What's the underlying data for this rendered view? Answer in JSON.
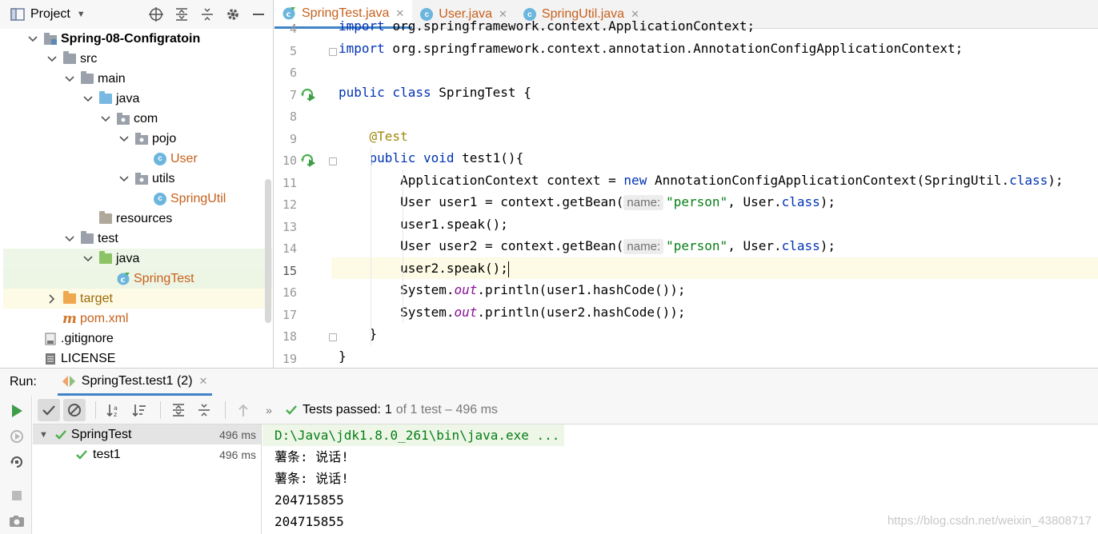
{
  "project": {
    "title": "Project",
    "tree": [
      {
        "label": "Spring-08-Configratoin",
        "depth": 1,
        "arrow": "down",
        "icon": "module",
        "style": "bold"
      },
      {
        "label": "src",
        "depth": 2,
        "arrow": "down",
        "icon": "folder-grey"
      },
      {
        "label": "main",
        "depth": 3,
        "arrow": "down",
        "icon": "folder-grey"
      },
      {
        "label": "java",
        "depth": 4,
        "arrow": "down",
        "icon": "folder-blue"
      },
      {
        "label": "com",
        "depth": 5,
        "arrow": "down",
        "icon": "package"
      },
      {
        "label": "pojo",
        "depth": 6,
        "arrow": "down",
        "icon": "package"
      },
      {
        "label": "User",
        "depth": 7,
        "arrow": "",
        "icon": "class",
        "style": "orange"
      },
      {
        "label": "utils",
        "depth": 6,
        "arrow": "down",
        "icon": "package"
      },
      {
        "label": "SpringUtil",
        "depth": 7,
        "arrow": "",
        "icon": "class",
        "style": "orange"
      },
      {
        "label": "resources",
        "depth": 4,
        "arrow": "",
        "icon": "folder-res"
      },
      {
        "label": "test",
        "depth": 3,
        "arrow": "down",
        "icon": "folder-grey"
      },
      {
        "label": "java",
        "depth": 4,
        "arrow": "down",
        "icon": "folder-green",
        "row": "hl"
      },
      {
        "label": "SpringTest",
        "depth": 5,
        "arrow": "",
        "icon": "test-class",
        "style": "orange",
        "row": "sel"
      },
      {
        "label": "target",
        "depth": 2,
        "arrow": "right",
        "icon": "folder-orange",
        "style": "gold",
        "row": "target"
      },
      {
        "label": "pom.xml",
        "depth": 2,
        "arrow": "",
        "icon": "maven",
        "style": "orange"
      },
      {
        "label": ".gitignore",
        "depth": 1,
        "arrow": "",
        "icon": "file"
      },
      {
        "label": "LICENSE",
        "depth": 1,
        "arrow": "",
        "icon": "file-lines"
      }
    ]
  },
  "editor": {
    "tabs": [
      {
        "label": "SpringTest.java",
        "icon": "test-class",
        "active": true
      },
      {
        "label": "User.java",
        "icon": "class",
        "active": false
      },
      {
        "label": "SpringUtil.java",
        "icon": "class",
        "active": false
      }
    ],
    "line_numbers": [
      "4",
      "5",
      "6",
      "7",
      "8",
      "9",
      "10",
      "11",
      "12",
      "13",
      "14",
      "15",
      "16",
      "17",
      "18",
      "19"
    ],
    "top_cut_line": "import org.springframework.context.ApplicationContext;",
    "current_line": "15"
  },
  "run": {
    "label": "Run:",
    "tab_label": "SpringTest.test1 (2)",
    "status_bold": "Tests passed:",
    "status_count": "1",
    "status_rest": "of 1 test – 496 ms",
    "tests": [
      {
        "name": "SpringTest",
        "time": "496 ms"
      },
      {
        "name": "test1",
        "time": "496 ms"
      }
    ],
    "console": [
      "D:\\Java\\jdk1.8.0_261\\bin\\java.exe ...",
      "薯条: 说话!",
      "薯条: 说话!",
      "204715855",
      "204715855"
    ],
    "watermark": "https://blog.csdn.net/weixin_43808717"
  },
  "colors": {
    "keyword": "#0033b3",
    "string": "#067d17",
    "annotation": "#9e880d",
    "file_orange": "#c7601c",
    "accent_blue": "#4083c9",
    "passed_green": "#4caf50"
  }
}
